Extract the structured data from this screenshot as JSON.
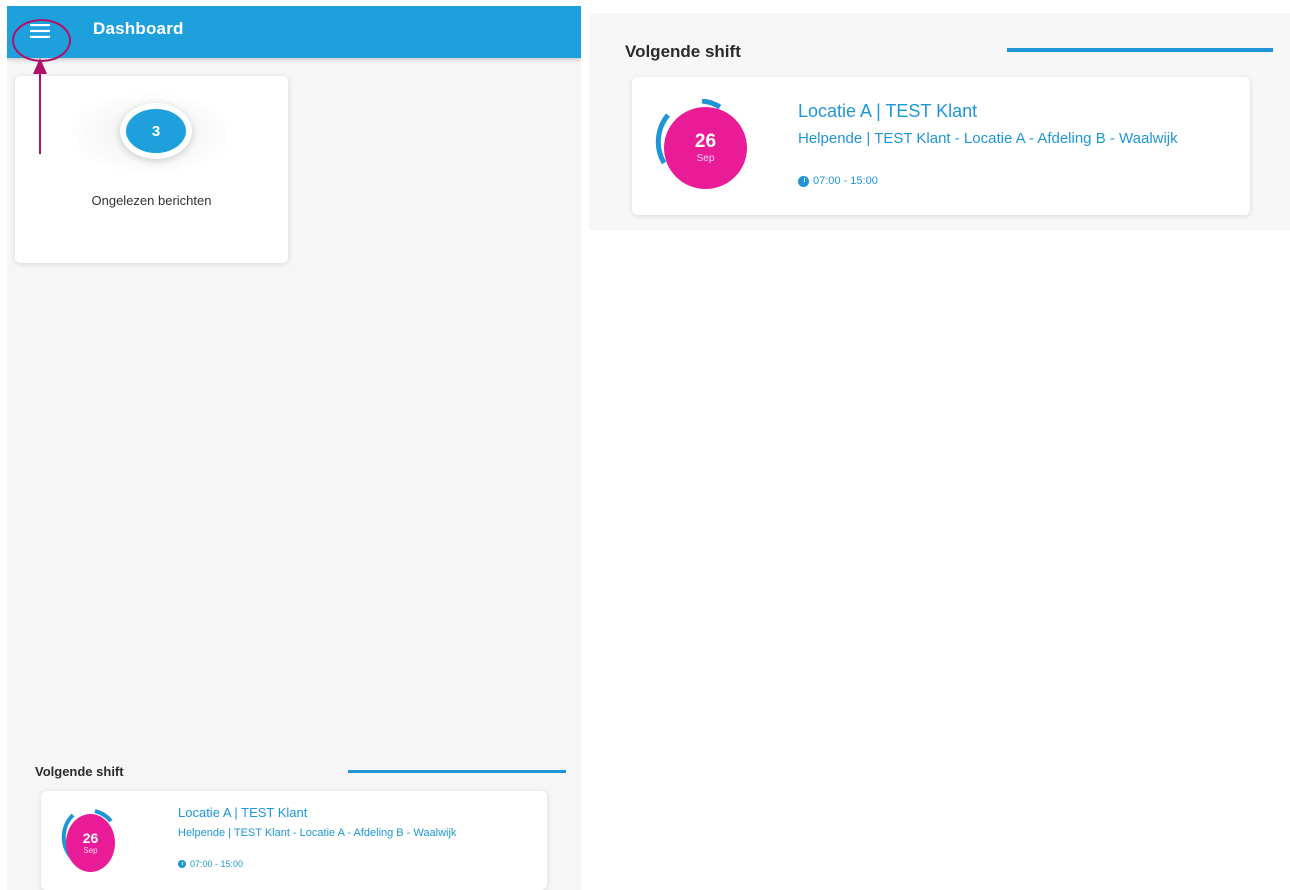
{
  "app_bar": {
    "title": "Dashboard",
    "menu_icon": "hamburger-menu-icon",
    "color": "#1ea0dc"
  },
  "unread_card": {
    "count": "3",
    "label": "Ongelezen berichten"
  },
  "next_shift": {
    "heading": "Volgende shift",
    "day": "26",
    "month": "Sep",
    "title": "Locatie A | TEST Klant",
    "subtitle": "Helpende | TEST Klant - Locatie A - Afdeling B - Waalwijk",
    "time": "07:00 - 15:00",
    "time_icon": "clock-icon",
    "date_color": "#ea1b97",
    "accent_color": "#1e96d6"
  },
  "annotation": {
    "color": "#b0106a"
  }
}
